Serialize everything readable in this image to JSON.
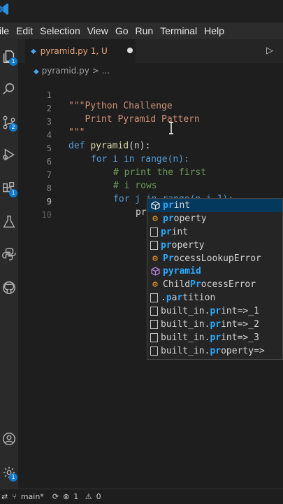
{
  "menu": [
    "ile",
    "Edit",
    "Selection",
    "View",
    "Go",
    "Run",
    "Terminal",
    "Help"
  ],
  "activity_badges": {
    "explorer": "1",
    "source_control": "2",
    "extensions": "1",
    "settings": "1"
  },
  "tab": {
    "label": "pyramid.py 1, U",
    "modified": true
  },
  "breadcrumb": {
    "file": "pyramid.py",
    "rest": "> ..."
  },
  "editor": {
    "lines": [
      {
        "n": "1",
        "text": "\"\"\"Python Challenge"
      },
      {
        "n": "2",
        "text": "   Print Pyramid Pattern"
      },
      {
        "n": "3",
        "text": "\"\"\""
      },
      {
        "n": "4",
        "kw": "def",
        "fn": "pyramid",
        "rest": "(n):"
      },
      {
        "n": "5",
        "text": "for i in range(n):"
      },
      {
        "n": "6",
        "text": "# print the first"
      },
      {
        "n": "7",
        "text": "# i rows"
      },
      {
        "n": "8",
        "text": "for j in range(n-i-1):"
      },
      {
        "n": "9",
        "text": "pr"
      },
      {
        "n": "10",
        "text": ""
      }
    ]
  },
  "suggestions": [
    {
      "match": "pr",
      "rest": "int",
      "icon": "cube"
    },
    {
      "match": "pr",
      "rest": "operty",
      "icon": "class"
    },
    {
      "match": "pr",
      "rest": "int",
      "icon": "text"
    },
    {
      "match": "pr",
      "rest": "operty",
      "icon": "text"
    },
    {
      "match": "Pr",
      "rest": "ocessLookupError",
      "icon": "class"
    },
    {
      "match": "pyramid",
      "rest": "",
      "icon": "method"
    },
    {
      "prefix": "Child",
      "match": "Pr",
      "rest": "ocessError",
      "icon": "class"
    },
    {
      "prefix": ".",
      "match": "p",
      "rest": "a",
      "match2": "r",
      "rest2": "tition",
      "icon": "text"
    },
    {
      "prefix": "built_in.",
      "match": "pr",
      "rest": "int=>_1",
      "icon": "text"
    },
    {
      "prefix": "built_in.",
      "match": "pr",
      "rest": "int=>_2",
      "icon": "text"
    },
    {
      "prefix": "built_in.",
      "match": "pr",
      "rest": "int=>_3",
      "icon": "text"
    },
    {
      "prefix": "built_in.",
      "match": "pr",
      "rest": "operty=>",
      "icon": "text"
    }
  ],
  "status": {
    "branch": "main*",
    "errors": "1",
    "warnings": "0"
  },
  "colors": {
    "accent": "#0e7acd",
    "keyword": "#569cd6",
    "function": "#dcdcaa",
    "comment": "#6a9955",
    "string": "#ce9178",
    "match": "#2aaaff"
  }
}
